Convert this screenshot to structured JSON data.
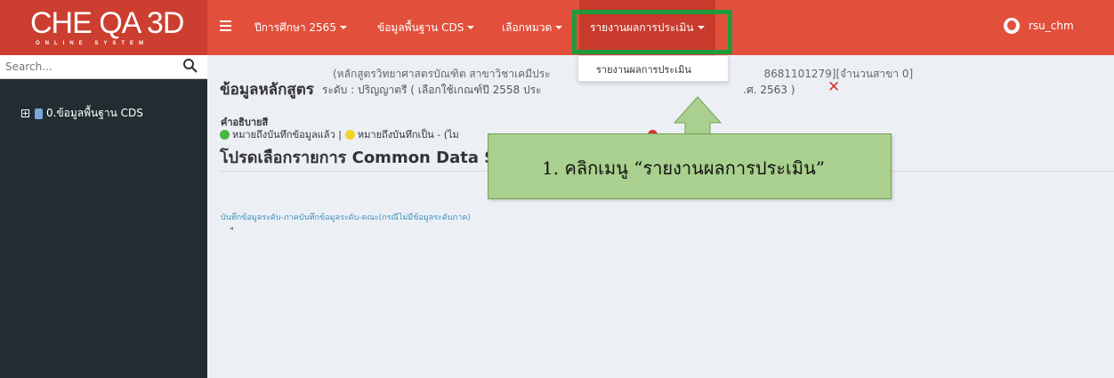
{
  "brand": {
    "logo_text": "CHE QA 3D",
    "logo_subtitle": "ONLINE SYSTEM"
  },
  "nav": {
    "academic_year": "ปีการศึกษา 2565",
    "cds": "ข้อมูลพื้นฐาน CDS",
    "category": "เลือกหมวด",
    "report": "รายงานผลการประเมิน",
    "user": "rsu_chm"
  },
  "sidebar": {
    "search_placeholder": "Search...",
    "tree_item": "0.ข้อมูลพื้นฐาน CDS"
  },
  "main": {
    "program_line": "(หลักสูตรวิทยาศาสตรบัณฑิต สาขาวิชาเคมีประ",
    "program_line_tail": "8681101279][จำนวนสาขา 0]",
    "title": "ข้อมูลหลักสูตร",
    "level_line": "ระดับ : ปริญญาตรี ( เลือกใช้เกณฑ์ปี 2558 ประ",
    "level_line_tail": ".ศ. 2563 )",
    "legend_label": "คำอธิบายสี",
    "legend_green": "หมายถึงบันทึกข้อมูลแล้ว |",
    "legend_yellow": "หมายถึงบันทึกเป็น - (ไม",
    "legend_red": "",
    "heading": "โปรดเลือกรายการ Common Data S",
    "link_text": "บันทึกข้อมูลระดับ-ภาคบันทึกข้อมูลระดับ-คณะ(กรณีไม่มีข้อมูลระดับภาค)",
    "scroll_arrow": "◂"
  },
  "dropdown": {
    "item": "รายงานผลการประเมิน"
  },
  "callout": {
    "text": "1. คลิกเมนู “รายงานผลการประเมิน”"
  },
  "colors": {
    "topbar": "#e2503c",
    "brand": "#cc3e2f",
    "sidebar": "#222d32",
    "highlight": "#1f9a3b",
    "callout": "#a9d08e"
  }
}
